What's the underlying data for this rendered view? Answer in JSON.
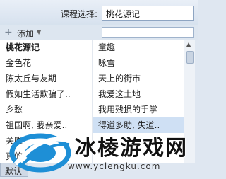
{
  "header": {
    "course_label": "课程选择:",
    "course_value": "桃花源记"
  },
  "toolbar": {
    "add_label": "添加",
    "search_placeholder": ""
  },
  "list": {
    "left": [
      {
        "label": "桃花源记",
        "bold": true
      },
      {
        "label": "金色花"
      },
      {
        "label": "陈太丘与友期"
      },
      {
        "label": "假如生活欺骗了.."
      },
      {
        "label": "乡愁"
      },
      {
        "label": "祖国啊, 我亲爱.."
      },
      {
        "label": "关雎"
      },
      {
        "label": "真的"
      }
    ],
    "right": [
      {
        "label": "童趣"
      },
      {
        "label": "咏雪"
      },
      {
        "label": "天上的街市"
      },
      {
        "label": "我爱这土地"
      },
      {
        "label": "我用残损的手掌"
      },
      {
        "label": "得道多助, 失道..",
        "selected": true
      }
    ]
  },
  "footer": {
    "default_button": "默认"
  },
  "watermark": {
    "title": "冰棱游戏网",
    "url": "www.yclengku.com"
  },
  "colors": {
    "selection": "#cfe0f4",
    "logo_blue": "#1e8fd6"
  }
}
